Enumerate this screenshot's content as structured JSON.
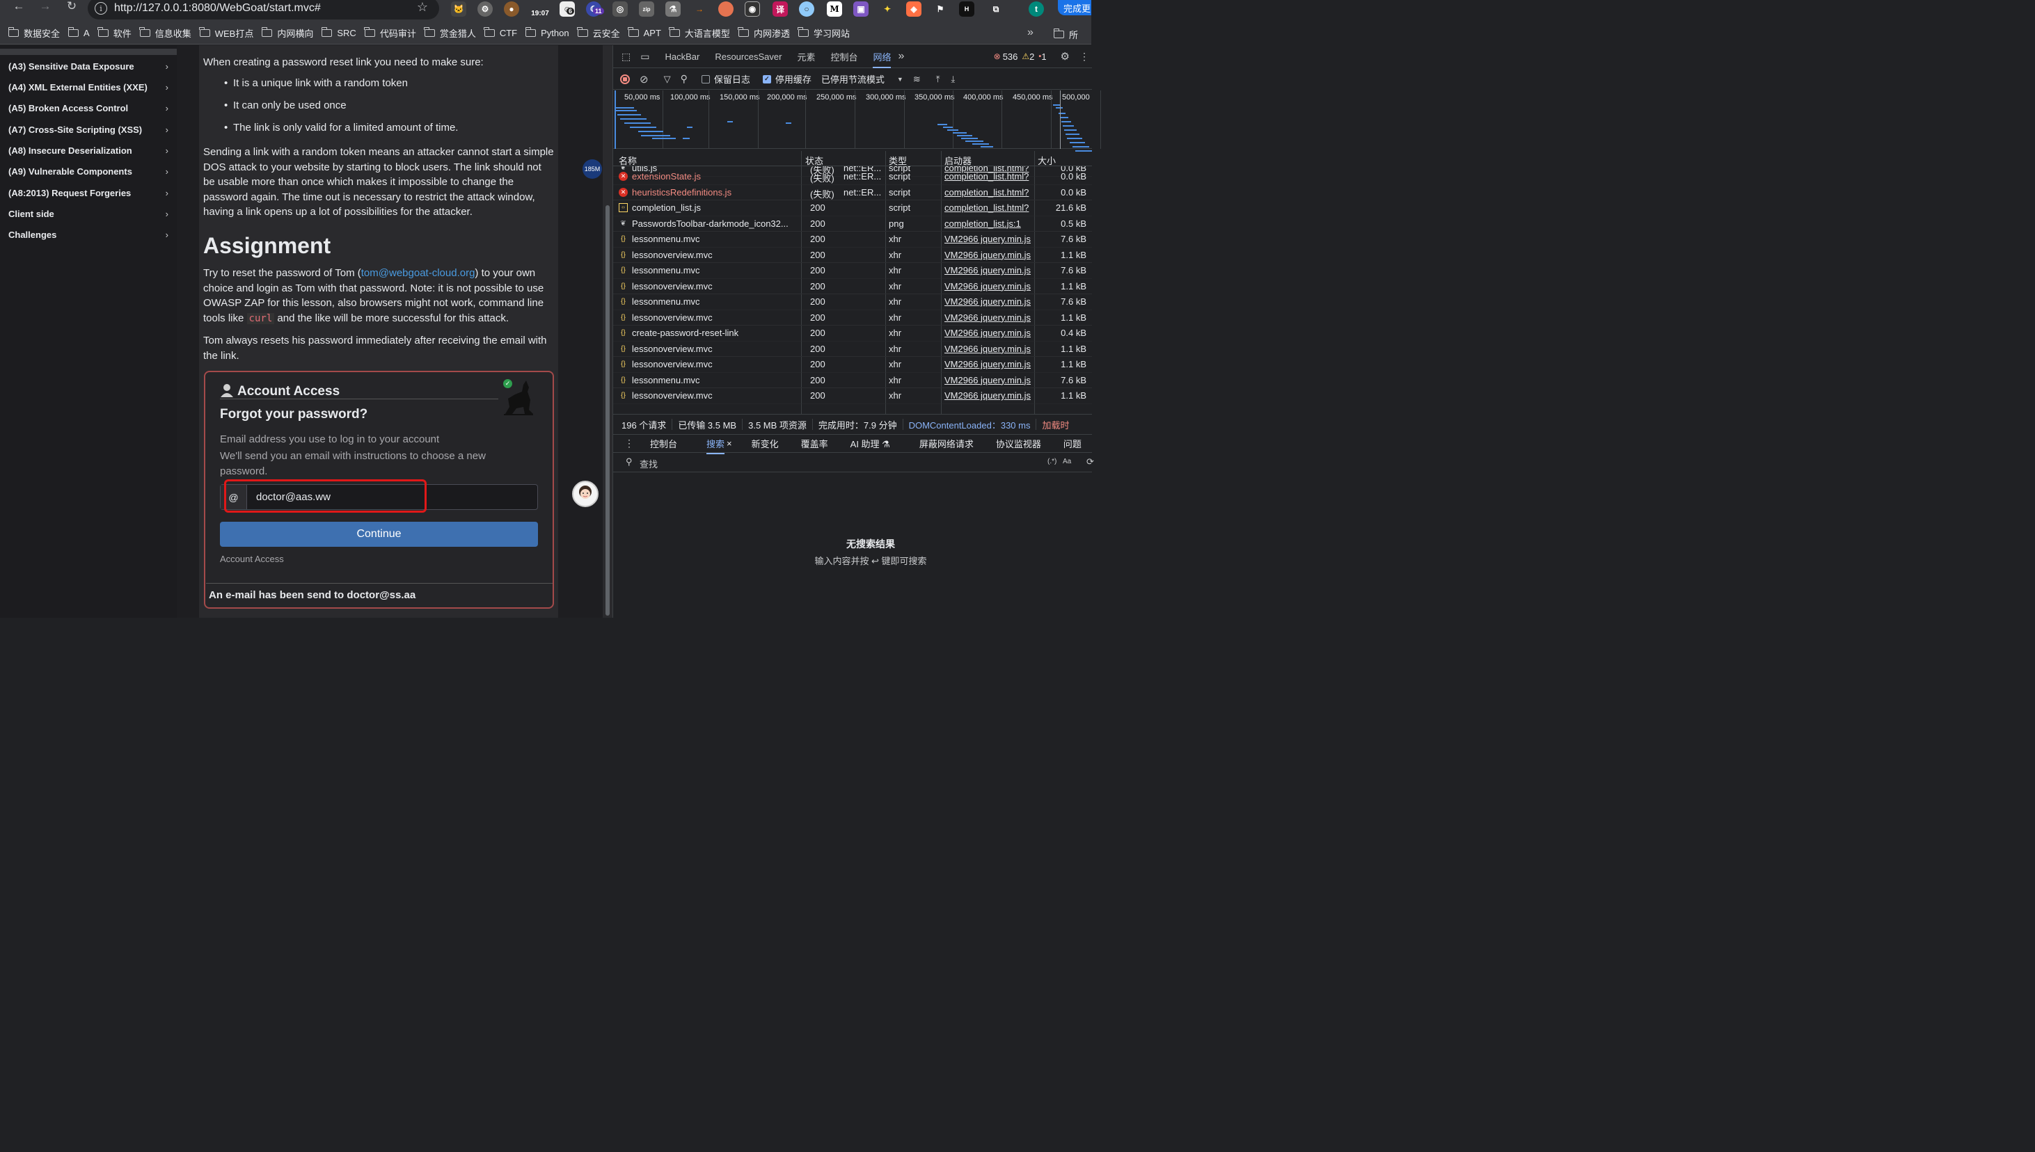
{
  "browser": {
    "url": "http://127.0.0.1:8080/WebGoat/start.mvc#",
    "ext_time": "19:07",
    "ext_badge_6": "6",
    "ext_badge_11": "11",
    "finish_label": "完成更"
  },
  "bookmarks": [
    "数据安全",
    "A",
    "软件",
    "信息收集",
    "WEB打点",
    "内网横向",
    "SRC",
    "代码审计",
    "赏金猎人",
    "CTF",
    "Python",
    "云安全",
    "APT",
    "大语言模型",
    "内网渗透",
    "学习网站"
  ],
  "bookmarks_more": "»",
  "bookmarks_last": "所",
  "sidebar": {
    "items": [
      {
        "label": "(A3) Sensitive Data Exposure"
      },
      {
        "label": "(A4) XML External Entities (XXE)"
      },
      {
        "label": "(A5) Broken Access Control"
      },
      {
        "label": "(A7) Cross-Site Scripting (XSS)"
      },
      {
        "label": "(A8) Insecure Deserialization"
      },
      {
        "label": "(A9) Vulnerable Components"
      },
      {
        "label": "(A8:2013) Request Forgeries"
      },
      {
        "label": "Client side"
      },
      {
        "label": "Challenges"
      }
    ],
    "chevron": "›"
  },
  "lesson": {
    "intro": "When creating a password reset link you need to make sure:",
    "bullets": [
      "It is a unique link with a random token",
      "It can only be used once",
      "The link is only valid for a limited amount of time."
    ],
    "para1": "Sending a link with a random token means an attacker cannot start a simple DOS attack to your website by starting to block users. The link should not be usable more than once which makes it impossible to change the password again. The time out is necessary to restrict the attack window, having a link opens up a lot of possibilities for the attacker.",
    "assignment_title": "Assignment",
    "para2_a": "Try to reset the password of Tom (",
    "para2_link": "tom@webgoat-cloud.org",
    "para2_b": ") to your own choice and login as Tom with that password. Note: it is not possible to use OWASP ZAP for this lesson, also browsers might not work, command line tools like ",
    "para2_code": "curl",
    "para2_c": " and the like will be more successful for this attack.",
    "para3": "Tom always resets his password immediately after receiving the email with the link."
  },
  "card": {
    "title": "Account Access",
    "heading": "Forgot your password?",
    "desc1": "Email address you use to log in to your account",
    "desc2": "We'll send you an email with instructions to choose a new password.",
    "at": "@",
    "email_value": "doctor@aas.ww",
    "continue": "Continue",
    "footer_link": "Account Access",
    "feedback": "An e-mail has been send to doctor@ss.aa"
  },
  "floating": {
    "pill": "185M"
  },
  "devtools": {
    "tabs": [
      "HackBar",
      "ResourcesSaver",
      "元素",
      "控制台",
      "网络"
    ],
    "more": "»",
    "errors": "536",
    "warnings": "2",
    "issues": "1",
    "preserve_log": "保留日志",
    "disable_cache": "停用缓存",
    "throttle": "已停用节流模式",
    "ticks": [
      "50,000 ms",
      "100,000 ms",
      "150,000 ms",
      "200,000 ms",
      "250,000 ms",
      "300,000 ms",
      "350,000 ms",
      "400,000 ms",
      "450,000 ms",
      "500,000"
    ],
    "headers": {
      "name": "名称",
      "status": "状态",
      "type": "类型",
      "initiator": "启动器",
      "size": "大小"
    },
    "partial_row": {
      "name": "utils.js",
      "status": "(失败)",
      "detail": "net::ER...",
      "type": "script",
      "initiator": "completion_list.html?",
      "size": "0.0 kB"
    },
    "rows": [
      {
        "icon": "error",
        "name": "extensionState.js",
        "status": "(失败)",
        "detail": "net::ER...",
        "type": "script",
        "initiator": "completion_list.html?",
        "size": "0.0 kB"
      },
      {
        "icon": "error",
        "name": "heuristicsRedefinitions.js",
        "status": "(失败)",
        "detail": "net::ER...",
        "type": "script",
        "initiator": "completion_list.html?",
        "size": "0.0 kB"
      },
      {
        "icon": "script",
        "name": "completion_list.js",
        "status": "200",
        "detail": "",
        "type": "script",
        "initiator": "completion_list.html?",
        "size": "21.6 kB"
      },
      {
        "icon": "png",
        "name": "PasswordsToolbar-darkmode_icon32...",
        "status": "200",
        "detail": "",
        "type": "png",
        "initiator": "completion_list.js:1",
        "size": "0.5 kB"
      },
      {
        "icon": "xhr",
        "name": "lessonmenu.mvc",
        "status": "200",
        "detail": "",
        "type": "xhr",
        "initiator": "VM2966 jquery.min.js",
        "size": "7.6 kB"
      },
      {
        "icon": "xhr",
        "name": "lessonoverview.mvc",
        "status": "200",
        "detail": "",
        "type": "xhr",
        "initiator": "VM2966 jquery.min.js",
        "size": "1.1 kB"
      },
      {
        "icon": "xhr",
        "name": "lessonmenu.mvc",
        "status": "200",
        "detail": "",
        "type": "xhr",
        "initiator": "VM2966 jquery.min.js",
        "size": "7.6 kB"
      },
      {
        "icon": "xhr",
        "name": "lessonoverview.mvc",
        "status": "200",
        "detail": "",
        "type": "xhr",
        "initiator": "VM2966 jquery.min.js",
        "size": "1.1 kB"
      },
      {
        "icon": "xhr",
        "name": "lessonmenu.mvc",
        "status": "200",
        "detail": "",
        "type": "xhr",
        "initiator": "VM2966 jquery.min.js",
        "size": "7.6 kB"
      },
      {
        "icon": "xhr",
        "name": "lessonoverview.mvc",
        "status": "200",
        "detail": "",
        "type": "xhr",
        "initiator": "VM2966 jquery.min.js",
        "size": "1.1 kB"
      },
      {
        "icon": "xhr",
        "name": "create-password-reset-link",
        "status": "200",
        "detail": "",
        "type": "xhr",
        "initiator": "VM2966 jquery.min.js",
        "size": "0.4 kB"
      },
      {
        "icon": "xhr",
        "name": "lessonoverview.mvc",
        "status": "200",
        "detail": "",
        "type": "xhr",
        "initiator": "VM2966 jquery.min.js",
        "size": "1.1 kB"
      },
      {
        "icon": "xhr",
        "name": "lessonoverview.mvc",
        "status": "200",
        "detail": "",
        "type": "xhr",
        "initiator": "VM2966 jquery.min.js",
        "size": "1.1 kB"
      },
      {
        "icon": "xhr",
        "name": "lessonmenu.mvc",
        "status": "200",
        "detail": "",
        "type": "xhr",
        "initiator": "VM2966 jquery.min.js",
        "size": "7.6 kB"
      },
      {
        "icon": "xhr",
        "name": "lessonoverview.mvc",
        "status": "200",
        "detail": "",
        "type": "xhr",
        "initiator": "VM2966 jquery.min.js",
        "size": "1.1 kB"
      }
    ],
    "status": {
      "requests": "196 个请求",
      "transferred": "已传输 3.5 MB",
      "resources": "3.5 MB 项资源",
      "finish": "完成用时：7.9 分钟",
      "dcl": "DOMContentLoaded：330 ms",
      "load": "加载时"
    },
    "drawer_tabs": [
      "控制台",
      "搜索",
      "新变化",
      "覆盖率",
      "AI 助理 ⚗",
      "屏蔽网络请求",
      "协议监视器",
      "问题"
    ],
    "search_placeholder": "查找",
    "regex": "(.*)",
    "case": "Aa",
    "no_results": "无搜索结果",
    "no_results_hint": "输入内容并按 ↩ 键即可搜索"
  }
}
